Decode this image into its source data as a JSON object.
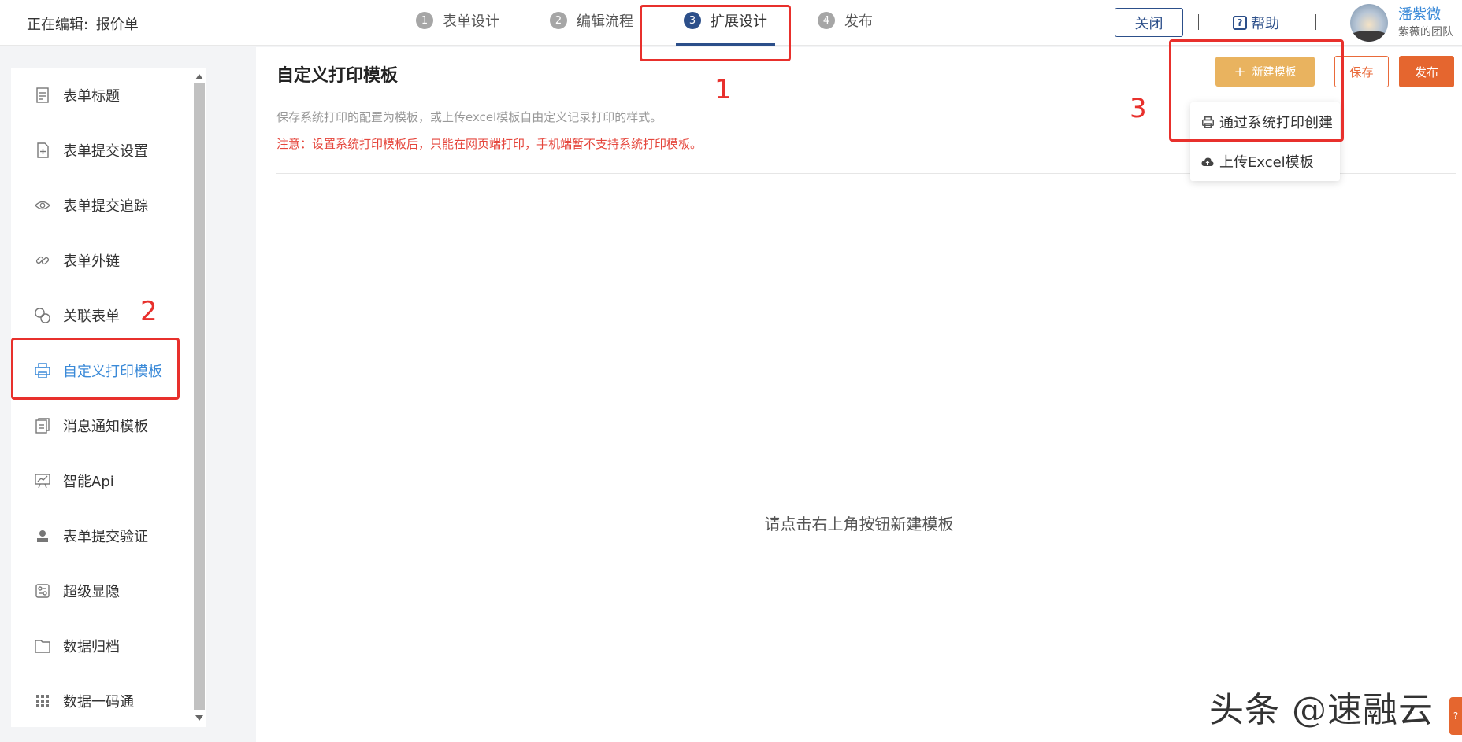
{
  "header": {
    "editing_label": "正在编辑:",
    "form_name": "报价单",
    "steps": [
      {
        "num": "1",
        "label": "表单设计"
      },
      {
        "num": "2",
        "label": "编辑流程"
      },
      {
        "num": "3",
        "label": "扩展设计"
      },
      {
        "num": "4",
        "label": "发布"
      }
    ],
    "close_label": "关闭",
    "divider_char": "|",
    "help_icon": "question-icon",
    "help_label": "帮助",
    "user_name": "潘紫微",
    "team_name": "紫薇的团队"
  },
  "sidebar": {
    "items": [
      {
        "label": "表单标题",
        "icon": "document-icon"
      },
      {
        "label": "表单提交设置",
        "icon": "file-plus-icon"
      },
      {
        "label": "表单提交追踪",
        "icon": "eye-icon"
      },
      {
        "label": "表单外链",
        "icon": "link-icon"
      },
      {
        "label": "关联表单",
        "icon": "circles-icon"
      },
      {
        "label": "自定义打印模板",
        "icon": "printer-icon"
      },
      {
        "label": "消息通知模板",
        "icon": "message-template-icon"
      },
      {
        "label": "智能Api",
        "icon": "chart-board-icon"
      },
      {
        "label": "表单提交验证",
        "icon": "user-icon"
      },
      {
        "label": "超级显隐",
        "icon": "toggles-icon"
      },
      {
        "label": "数据归档",
        "icon": "folder-icon"
      },
      {
        "label": "数据一码通",
        "icon": "grid-icon"
      }
    ],
    "active_index": 5
  },
  "main": {
    "title": "自定义打印模板",
    "description": "保存系统打印的配置为模板，或上传excel模板自由定义记录打印的样式。",
    "warning": "注意：设置系统打印模板后，只能在网页端打印，手机端暂不支持系统打印模板。",
    "empty_hint": "请点击右上角按钮新建模板",
    "new_template_label": "新建模板",
    "save_label": "保存",
    "publish_label": "发布",
    "dropdown": [
      {
        "label": "通过系统打印创建",
        "icon": "printer-icon"
      },
      {
        "label": "上传Excel模板",
        "icon": "cloud-upload-icon"
      }
    ]
  },
  "annotations": {
    "marks": [
      "1",
      "2",
      "3"
    ],
    "color": "#e8302c"
  },
  "watermark": "头条 @速融云",
  "colors": {
    "accent": "#2c4f8a",
    "link": "#3b8ad8",
    "new_button": "#e9b35f",
    "publish": "#e5662f",
    "warning": "#e5463c"
  }
}
